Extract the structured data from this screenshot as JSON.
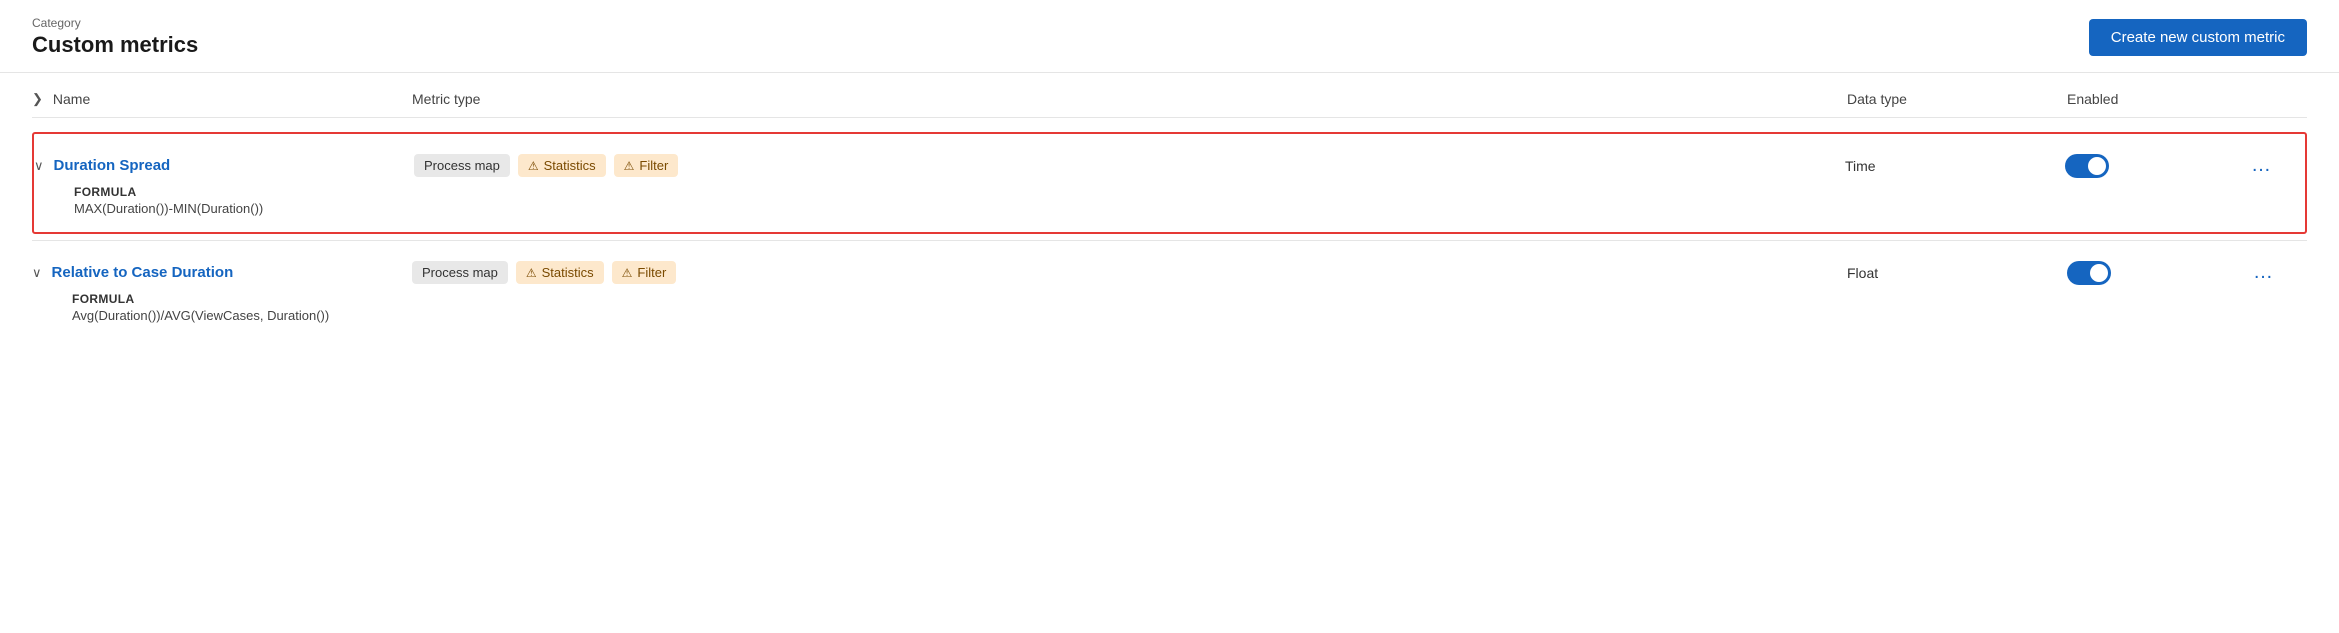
{
  "header": {
    "category_label": "Category",
    "page_title": "Custom metrics",
    "create_button": "Create new custom metric"
  },
  "table": {
    "columns": {
      "name": "Name",
      "metric_type": "Metric type",
      "data_type": "Data type",
      "enabled": "Enabled"
    },
    "rows": [
      {
        "id": "duration-spread",
        "name": "Duration Spread",
        "highlighted": true,
        "expanded": true,
        "metric_types": [
          {
            "label": "Process map",
            "style": "grey",
            "icon": ""
          },
          {
            "label": "Statistics",
            "style": "orange",
            "icon": "⚠"
          },
          {
            "label": "Filter",
            "style": "orange",
            "icon": "⚠"
          }
        ],
        "data_type": "Time",
        "enabled": true,
        "formula_label": "FORMULA",
        "formula_value": "MAX(Duration())-MIN(Duration())"
      },
      {
        "id": "relative-to-case-duration",
        "name": "Relative to Case Duration",
        "highlighted": false,
        "expanded": true,
        "metric_types": [
          {
            "label": "Process map",
            "style": "grey",
            "icon": ""
          },
          {
            "label": "Statistics",
            "style": "orange",
            "icon": "⚠"
          },
          {
            "label": "Filter",
            "style": "orange",
            "icon": "⚠"
          }
        ],
        "data_type": "Float",
        "enabled": true,
        "formula_label": "FORMULA",
        "formula_value": "Avg(Duration())/AVG(ViewCases, Duration())"
      }
    ]
  }
}
